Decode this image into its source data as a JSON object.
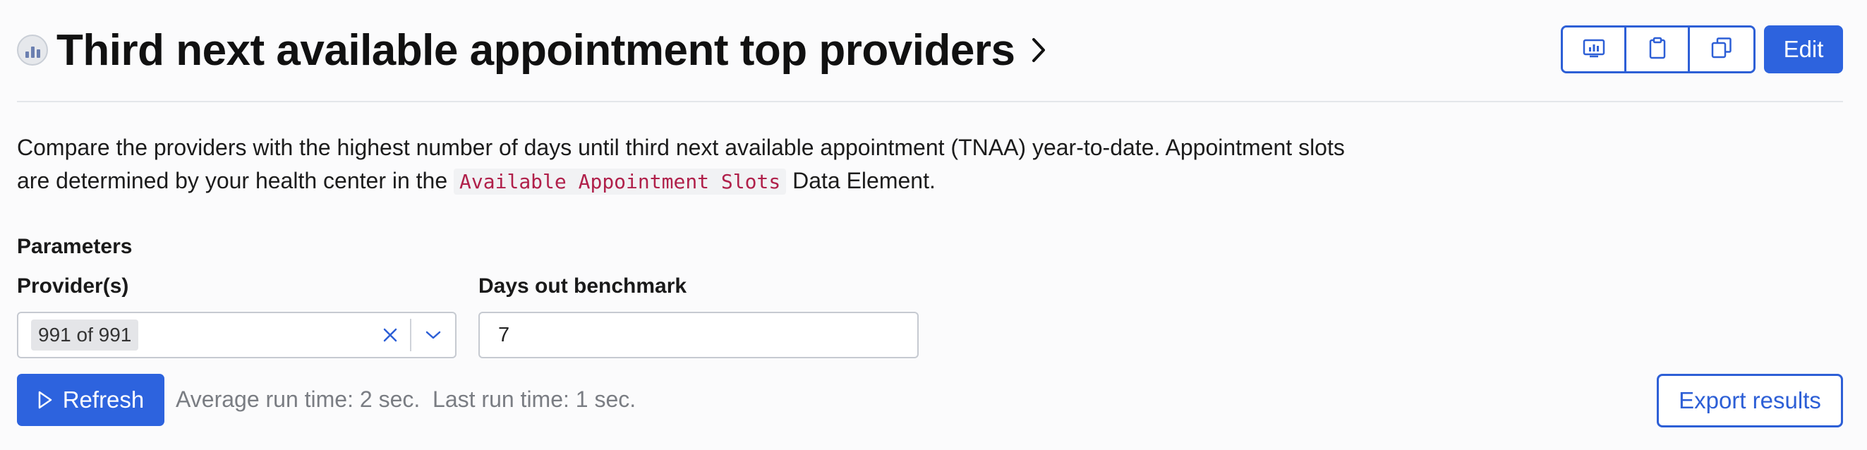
{
  "header": {
    "title": "Third next available appointment top providers",
    "title_icon": "chart-icon",
    "chevron_icon": "chevron-right-icon",
    "toolbar_icons": [
      "report-icon",
      "clipboard-icon",
      "copy-icon"
    ],
    "edit_label": "Edit"
  },
  "description": {
    "text_before": "Compare the providers with the highest number of days until third next available appointment (TNAA) year-to-date. Appointment slots are determined by your health center in the ",
    "code": "Available Appointment Slots",
    "text_after": " Data Element."
  },
  "parameters": {
    "heading": "Parameters",
    "providers": {
      "label": "Provider(s)",
      "selected": "991 of 991",
      "clear_icon": "close-icon",
      "dropdown_icon": "chevron-down-icon"
    },
    "benchmark": {
      "label": "Days out benchmark",
      "value": "7"
    }
  },
  "actions": {
    "refresh_label": "Refresh",
    "refresh_icon": "play-icon",
    "runtime_text": "Average run time: 2 sec.  Last run time: 1 sec.",
    "export_label": "Export results"
  },
  "colors": {
    "accent": "#2d63de",
    "code_text": "#b0204a",
    "muted_text": "#7a7d83"
  }
}
